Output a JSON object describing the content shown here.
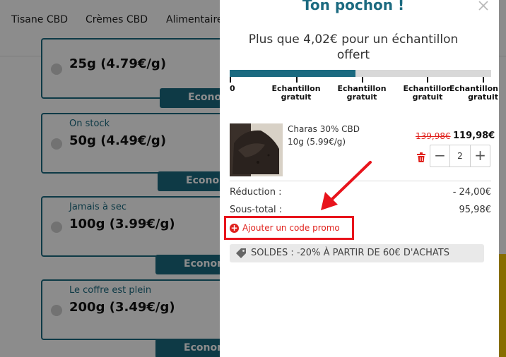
{
  "nav": {
    "links": [
      "Tisane CBD",
      "Crèmes CBD",
      "Alimentaire"
    ]
  },
  "options": [
    {
      "note": "",
      "weight": "25g (4.79€/g)",
      "button": "Econom"
    },
    {
      "note": "On stock",
      "weight": "50g (4.49€/g)",
      "button": "Econom"
    },
    {
      "note": "Jamais à sec",
      "weight": "100g (3.99€/g)",
      "button": "Econom"
    },
    {
      "note": "Le coffre est plein",
      "weight": "200g (3.49€/g)",
      "button": "Econom"
    }
  ],
  "cart": {
    "title": "Ton pochon !",
    "close_icon": "close-icon",
    "promo_message": "Plus que 4,02€ pour un échantillon offert",
    "progress_fraction": 0.48,
    "milestones": [
      {
        "label": "0"
      },
      {
        "label": "Echantillon\ngratuit"
      },
      {
        "label": "Echantillon\ngratuit"
      },
      {
        "label": "Echantillon\ngratuit"
      },
      {
        "label": "Echantillon\ngratuit"
      }
    ],
    "item": {
      "name": "Charas 30% CBD",
      "unit": "10g (5.99€/g)",
      "price_old": "139,98€",
      "price_new": "119,98€",
      "quantity": "2",
      "minus": "−",
      "plus": "+"
    },
    "summary": {
      "discount_label": "Réduction :",
      "discount_value": "- 24,00€",
      "subtotal_label": "Sous-total :",
      "subtotal_value": "95,98€"
    },
    "promo_code": {
      "icon_glyph": "+",
      "label": "Ajouter un code promo"
    },
    "sale_badge": "SOLDES : -20% À PARTIR DE 60€ D'ACHATS"
  },
  "colors": {
    "brand": "#1b6a80",
    "accent_red": "#e0211c",
    "annotation_red": "#e8141c",
    "overlay": "rgba(0,0,0,0.45)"
  }
}
